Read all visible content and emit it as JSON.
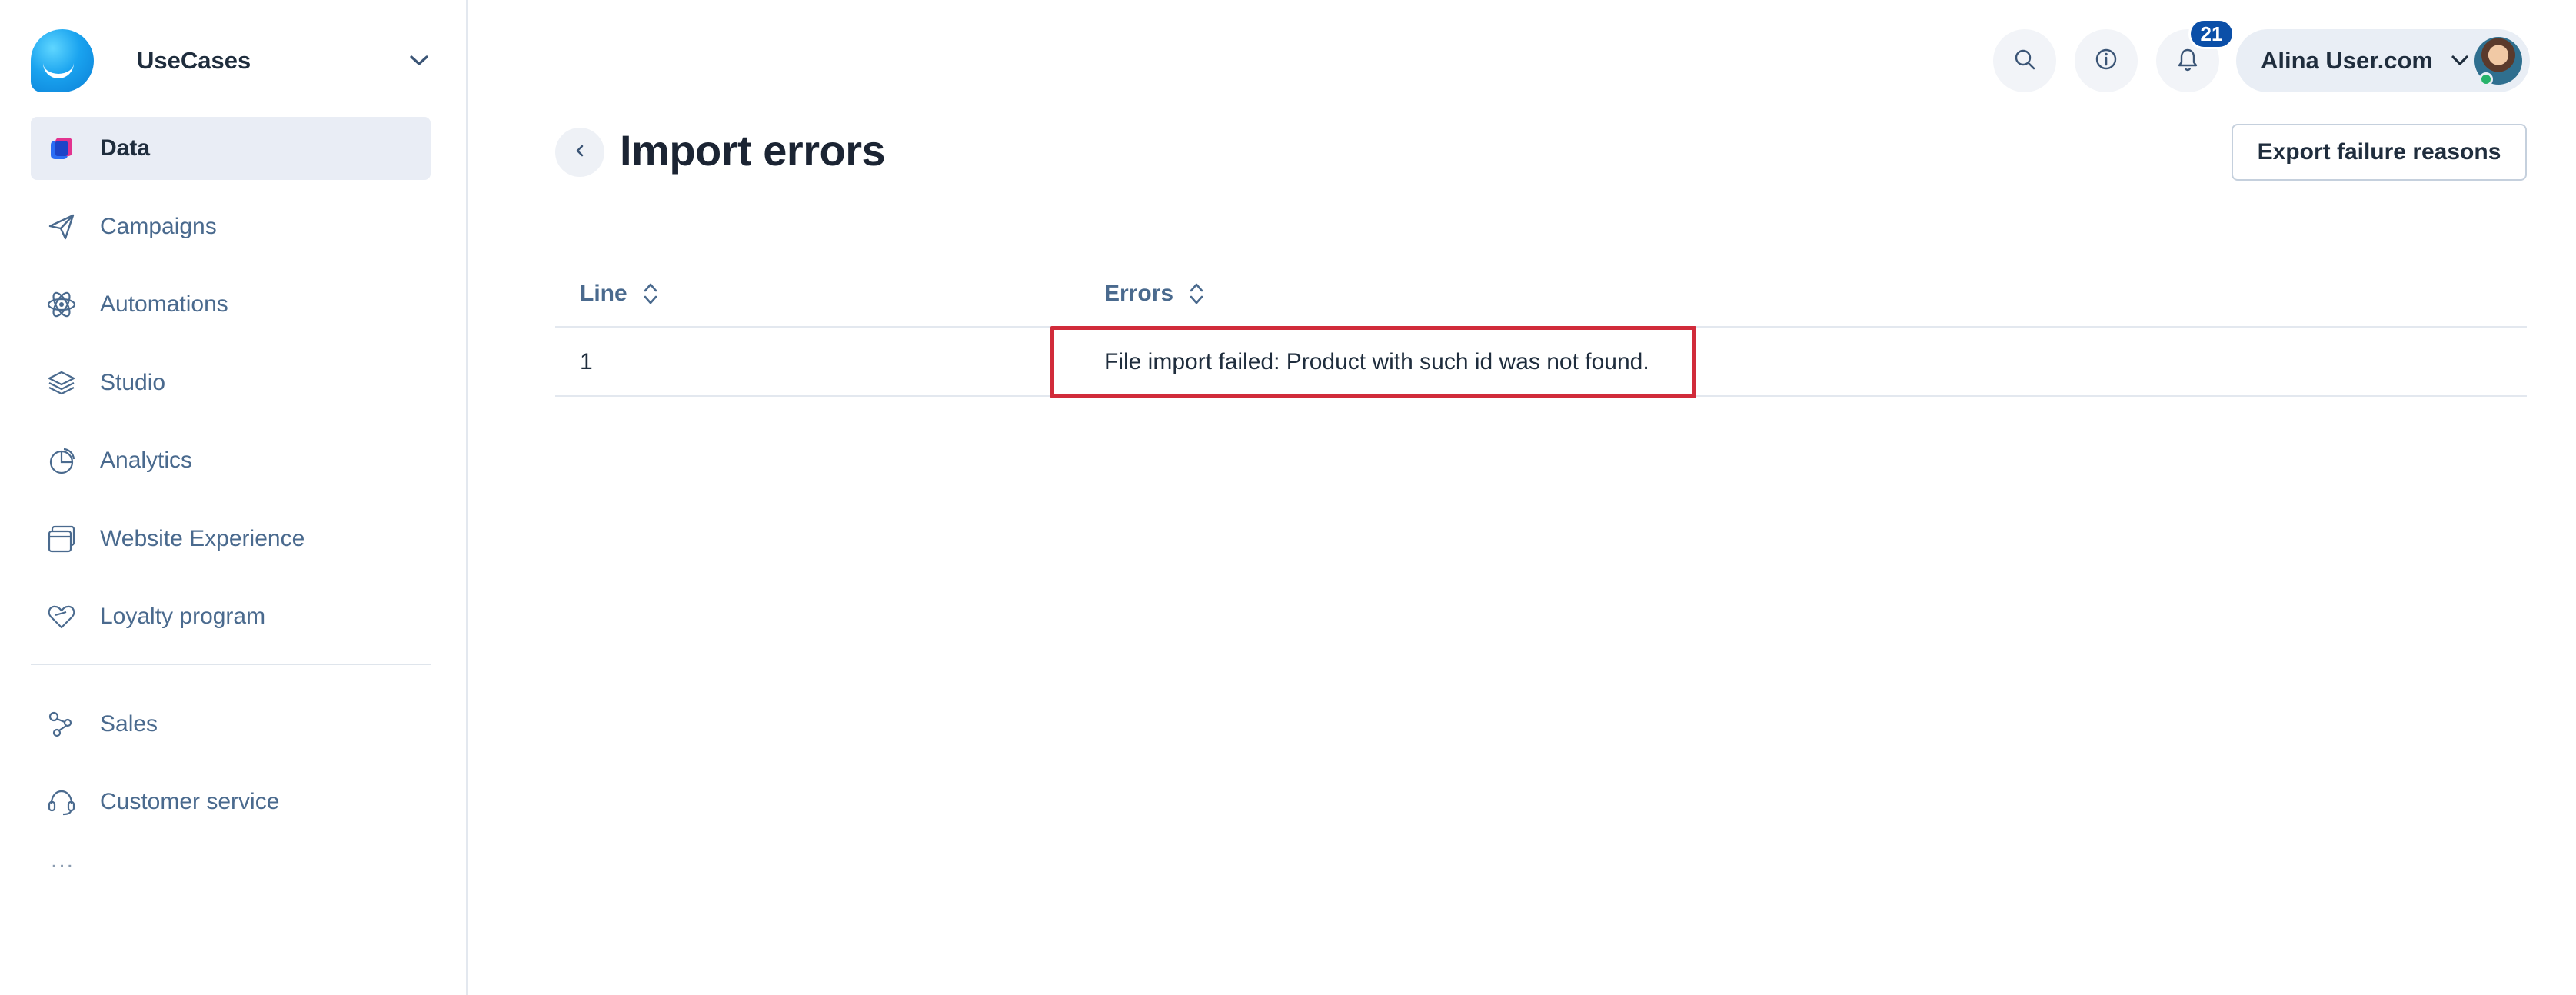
{
  "workspace": {
    "name": "UseCases"
  },
  "sidebar": {
    "items": [
      {
        "label": "Data",
        "icon": "data-icon",
        "active": true
      },
      {
        "label": "Campaigns",
        "icon": "paper-plane-icon"
      },
      {
        "label": "Automations",
        "icon": "atom-icon"
      },
      {
        "label": "Studio",
        "icon": "layers-icon"
      },
      {
        "label": "Analytics",
        "icon": "pie-chart-icon"
      },
      {
        "label": "Website Experience",
        "icon": "browser-window-icon"
      },
      {
        "label": "Loyalty program",
        "icon": "heart-tag-icon"
      }
    ],
    "secondary_items": [
      {
        "label": "Sales",
        "icon": "sales-pipeline-icon"
      },
      {
        "label": "Customer service",
        "icon": "headset-icon"
      }
    ],
    "more_label": "..."
  },
  "topbar": {
    "notifications_count": "21",
    "user_name": "Alina User.com"
  },
  "page": {
    "title": "Import errors",
    "export_button": "Export failure reasons"
  },
  "table": {
    "columns": [
      "Line",
      "Errors"
    ],
    "rows": [
      {
        "line": "1",
        "error": "File import failed: Product with such id was not found."
      }
    ]
  },
  "colors": {
    "accent": "#0b4fa8",
    "nav_text": "#4a6a8e",
    "active_bg": "#e9edf5",
    "highlight_border": "#d12b3a"
  }
}
